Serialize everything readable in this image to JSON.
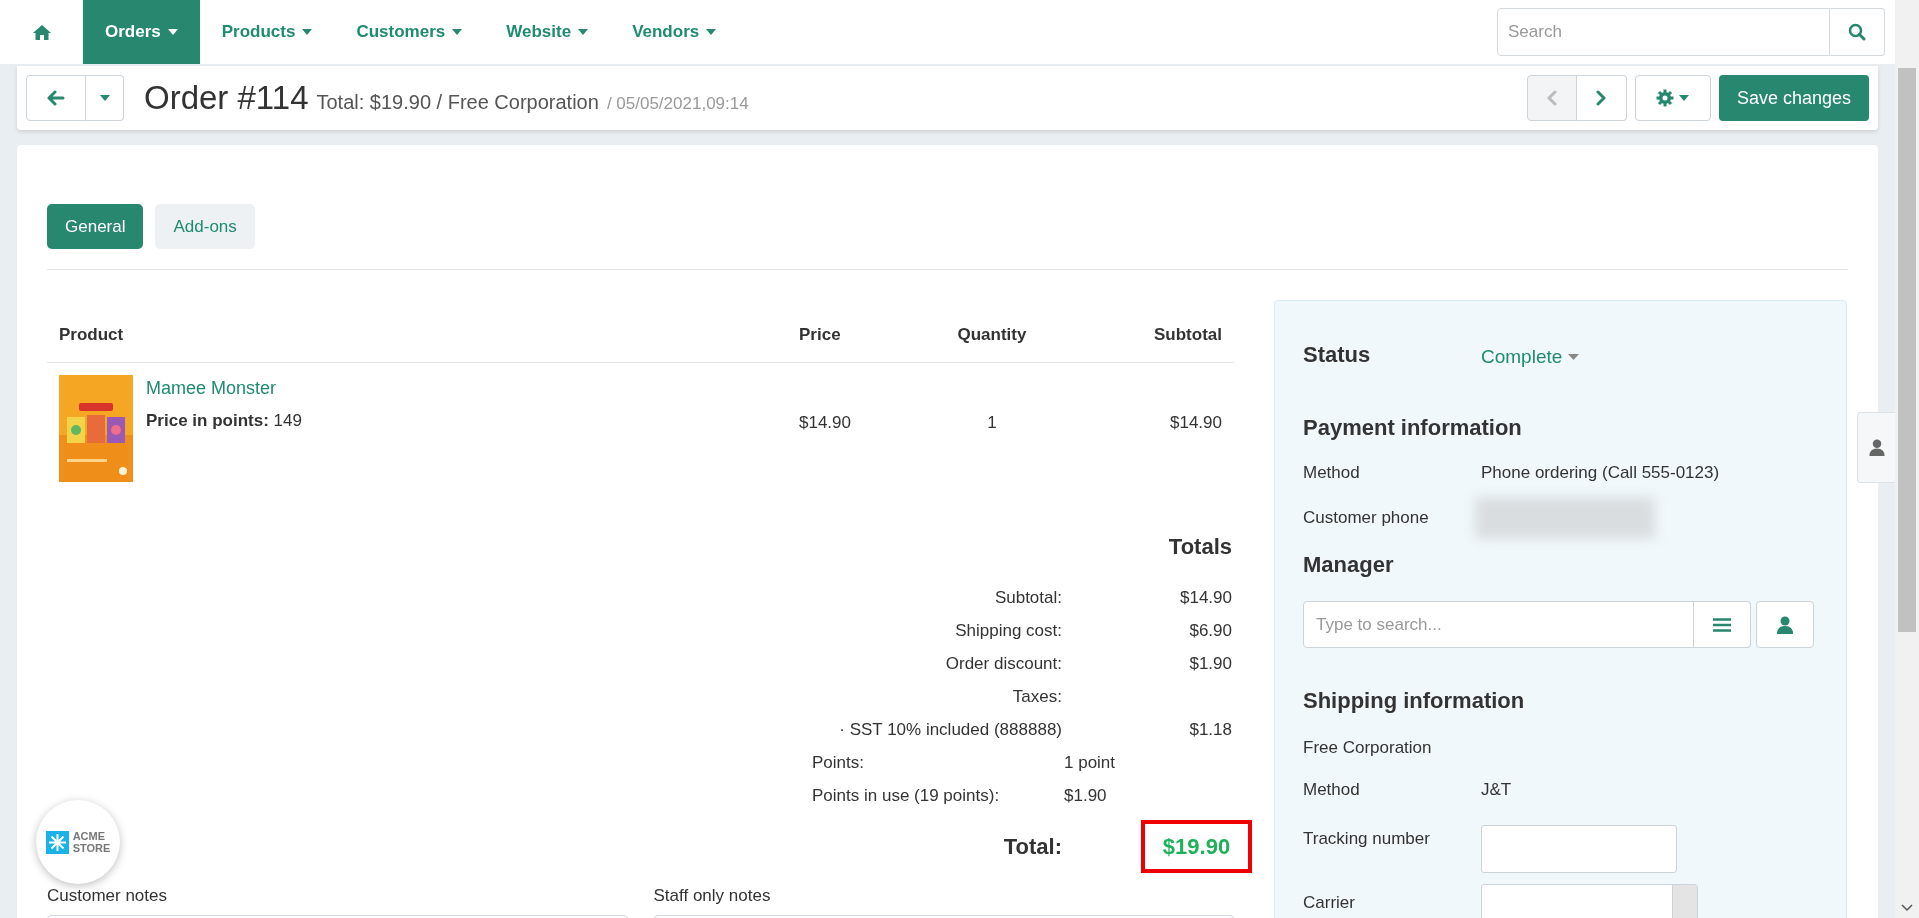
{
  "nav": {
    "items": [
      {
        "label": "Orders",
        "selected": true
      },
      {
        "label": "Products",
        "selected": false
      },
      {
        "label": "Customers",
        "selected": false
      },
      {
        "label": "Website",
        "selected": false
      },
      {
        "label": "Vendors",
        "selected": false
      }
    ],
    "search": {
      "placeholder": "Search"
    }
  },
  "header": {
    "title": "Order #114",
    "summary": "Total: $19.90 / Free Corporation",
    "date": "/ 05/05/2021,09:14",
    "prev": {
      "disabled": true
    },
    "next": {
      "disabled": false
    },
    "save_button": "Save changes"
  },
  "tabs": [
    {
      "label": "General",
      "selected": true
    },
    {
      "label": "Add-ons",
      "selected": false
    }
  ],
  "products": {
    "columns": [
      "Product",
      "Price",
      "Quantity",
      "Subtotal"
    ],
    "rows": [
      {
        "name": "Mamee Monster",
        "points": "**Price in points:** 149",
        "price": "$14.90",
        "quantity": "1",
        "subtotal": "$14.90"
      }
    ]
  },
  "totals": {
    "title": "Totals",
    "rows": [
      {
        "kind": "right",
        "label": "Subtotal:",
        "value": "$14.90"
      },
      {
        "kind": "right",
        "label": "Shipping cost:",
        "value": "$6.90"
      },
      {
        "kind": "right",
        "label": "Order discount:",
        "value": "$1.90"
      },
      {
        "kind": "right",
        "label": "Taxes:"
      },
      {
        "kind": "right",
        "label": "· SST 10% included (888888)",
        "value": "$1.18"
      },
      {
        "kind": "left",
        "label": "Points:",
        "value": "1 point"
      },
      {
        "kind": "left",
        "label": "Points in use (19 points):",
        "value": "$1.90"
      }
    ],
    "total": {
      "label": "Total:",
      "value": "$19.90",
      "highlighted": true
    }
  },
  "notes": [
    "Customer notes",
    "Staff only notes"
  ],
  "badge": {
    "line1": "ACME",
    "line2": "STORE"
  },
  "sidebar": {
    "status": {
      "label": "Status",
      "value": "Complete"
    },
    "payment": {
      "title": "Payment information",
      "fields": [
        {
          "kind": "text",
          "label": "Method",
          "value": "Phone ordering (Call 555-0123)"
        },
        {
          "kind": "blurred",
          "label": "Customer phone"
        }
      ]
    },
    "manager": {
      "title": "Manager",
      "placeholder": "Type to search..."
    },
    "shipping": {
      "title": "Shipping information",
      "name": "Free Corporation",
      "fields": [
        {
          "kind": "text",
          "label": "Method",
          "value": "J&T"
        },
        {
          "kind": "input",
          "label": "Tracking number"
        },
        {
          "kind": "select",
          "label": "Carrier"
        }
      ]
    }
  }
}
